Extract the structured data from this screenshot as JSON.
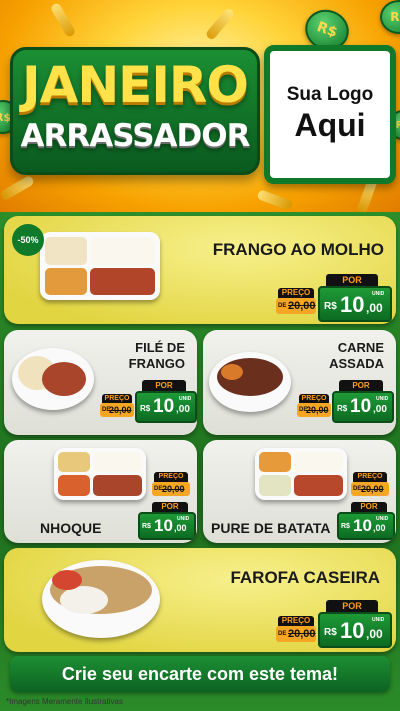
{
  "header": {
    "title_line1": "JANEIRO",
    "title_line2": "ARRASSADOR",
    "logo_line1": "Sua Logo",
    "logo_line2": "Aqui",
    "coin_symbol": "R$"
  },
  "currency": "R$",
  "unit_label": "UNID",
  "products": [
    {
      "name": "FRANGO AO MOLHO",
      "badge": "-50%",
      "preco_label": "PREÇO",
      "de_label": "DE",
      "old_price": "20,00",
      "por_label": "POR",
      "price_int": "10",
      "price_dec": ",00"
    },
    {
      "name": "FILÉ DE FRANGO",
      "preco_label": "PREÇO",
      "de_label": "DE",
      "old_price": "20,00",
      "por_label": "POR",
      "price_int": "10",
      "price_dec": ",00"
    },
    {
      "name": "CARNE ASSADA",
      "preco_label": "PREÇO",
      "de_label": "DE",
      "old_price": "20,00",
      "por_label": "POR",
      "price_int": "10",
      "price_dec": ",00"
    },
    {
      "name": "NHOQUE",
      "preco_label": "PREÇO",
      "de_label": "DE",
      "old_price": "20,00",
      "por_label": "POR",
      "price_int": "10",
      "price_dec": ",00"
    },
    {
      "name": "PURE DE BATATA",
      "preco_label": "PREÇO",
      "de_label": "DE",
      "old_price": "20,00",
      "por_label": "POR",
      "price_int": "10",
      "price_dec": ",00"
    },
    {
      "name": "FAROFA CASEIRA",
      "preco_label": "PREÇO",
      "de_label": "DE",
      "old_price": "20,00",
      "por_label": "POR",
      "price_int": "10",
      "price_dec": ",00"
    }
  ],
  "cta": "Crie seu encarte com este tema!",
  "footnote": "*Imagens Meramente Ilustrativas",
  "colors": {
    "brand_green": "#117a2a",
    "accent_yellow": "#ffd43a",
    "price_orange": "#f5a623"
  }
}
